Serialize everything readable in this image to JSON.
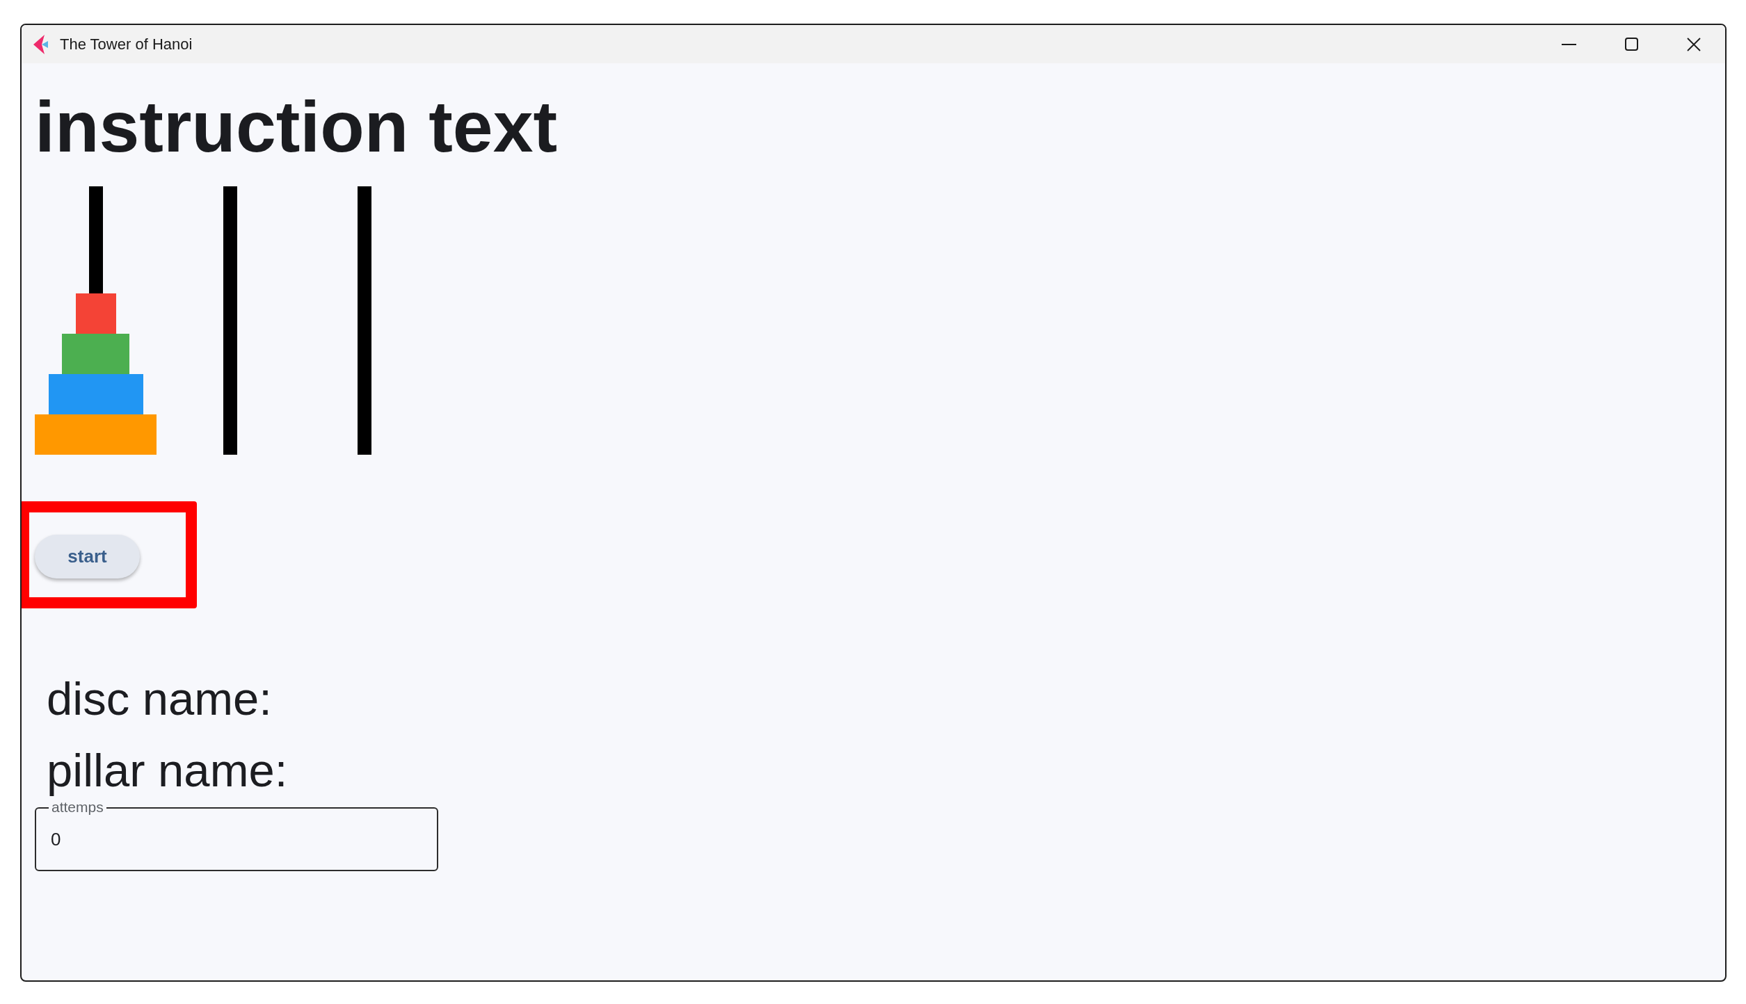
{
  "window": {
    "title": "The Tower of Hanoi"
  },
  "instruction": "instruction text",
  "board": {
    "pillars": [
      {
        "discs": [
          {
            "color": "#f44336"
          },
          {
            "color": "#4caf50"
          },
          {
            "color": "#2196f3"
          },
          {
            "color": "#ff9800"
          }
        ]
      }
    ]
  },
  "start_button": {
    "label": "start",
    "highlighted": true
  },
  "disc_name": {
    "label": "disc name:"
  },
  "pillar_name": {
    "label": "pillar name:"
  },
  "attempts_field": {
    "label": "attemps",
    "value": "0"
  }
}
